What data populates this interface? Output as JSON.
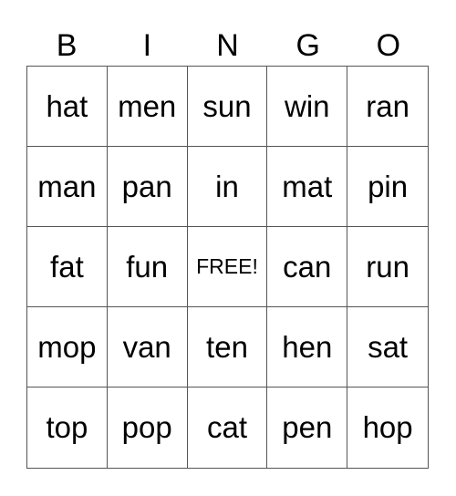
{
  "header": [
    "B",
    "I",
    "N",
    "G",
    "O"
  ],
  "cells": [
    [
      "hat",
      "men",
      "sun",
      "win",
      "ran"
    ],
    [
      "man",
      "pan",
      "in",
      "mat",
      "pin"
    ],
    [
      "fat",
      "fun",
      "FREE!",
      "can",
      "run"
    ],
    [
      "mop",
      "van",
      "ten",
      "hen",
      "sat"
    ],
    [
      "top",
      "pop",
      "cat",
      "pen",
      "hop"
    ]
  ],
  "free_cell": {
    "row": 2,
    "col": 2
  }
}
